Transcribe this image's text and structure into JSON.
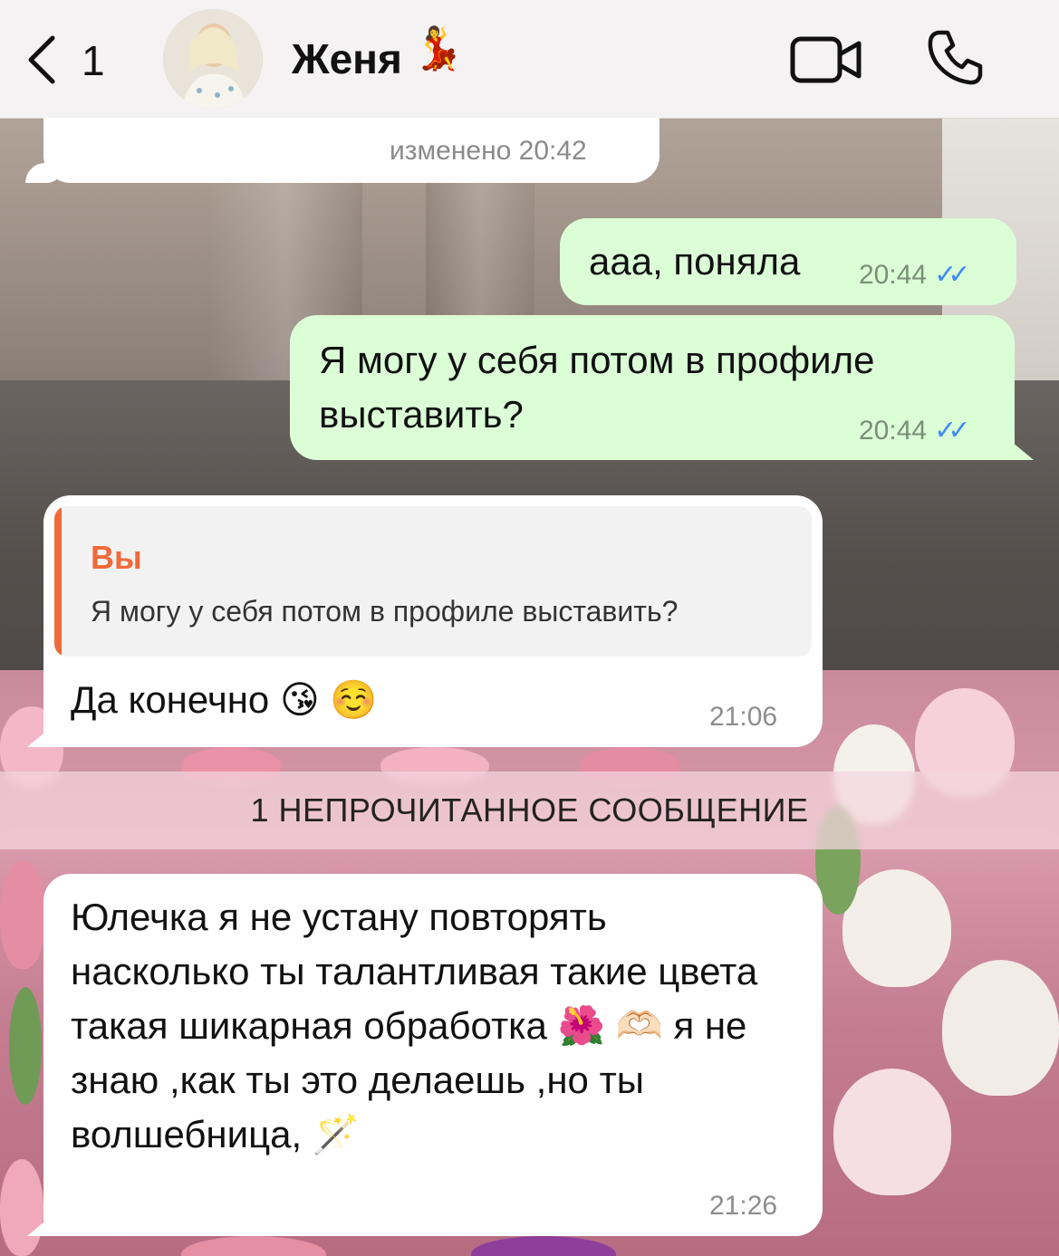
{
  "header": {
    "back_count": "1",
    "contact_name": "Женя",
    "contact_emoji": "💃",
    "icons": [
      "back-chevron-icon",
      "video-call-icon",
      "phone-icon"
    ]
  },
  "messages": [
    {
      "direction": "in",
      "text": "",
      "time": "изменено 20:42"
    },
    {
      "direction": "out",
      "text": "ааа, поняла",
      "time": "20:44",
      "status": "read"
    },
    {
      "direction": "out",
      "text": "Я могу у себя потом в профиле выставить?",
      "time": "20:44",
      "status": "read"
    },
    {
      "direction": "in",
      "reply": {
        "author": "Вы",
        "text": "Я могу у себя потом в профиле выставить?"
      },
      "text": "Да конечно 😘 ☺️",
      "time": "21:06"
    },
    {
      "direction": "in",
      "text": "Юлечка я не устану повторять насколько ты талантливая такие цвета такая шикарная обработка 🌺 🫶🏻 я не знаю ,как ты это делаешь ,но ты волшебница, 🪄",
      "time": "21:26"
    }
  ],
  "unread_banner": "1 НЕПРОЧИТАННОЕ СООБЩЕНИЕ",
  "ticks_glyph": "✓✓",
  "colors": {
    "header_bg": "#f4f2f2",
    "incoming_bubble": "#ffffff",
    "outgoing_bubble": "#dbfed7",
    "read_ticks": "#3f8bf5",
    "reply_accent": "#f06a3a"
  }
}
